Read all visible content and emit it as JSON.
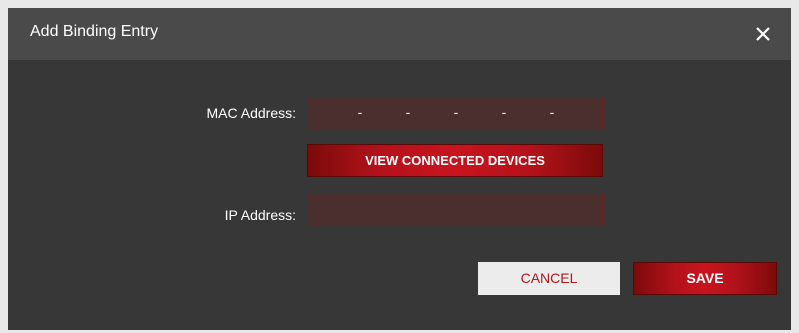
{
  "dialog": {
    "title": "Add Binding Entry",
    "close_icon": "close-icon"
  },
  "form": {
    "mac_label": "MAC Address:",
    "mac_value": "",
    "mac_separator": "-",
    "view_devices_label": "VIEW CONNECTED DEVICES",
    "ip_label": "IP Address:",
    "ip_value": ""
  },
  "actions": {
    "cancel_label": "CANCEL",
    "save_label": "SAVE"
  },
  "colors": {
    "accent": "#c8141e",
    "dialog_bg": "#373737",
    "titlebar_bg": "#4a4a4a",
    "field_bg": "#4b2e2e"
  }
}
